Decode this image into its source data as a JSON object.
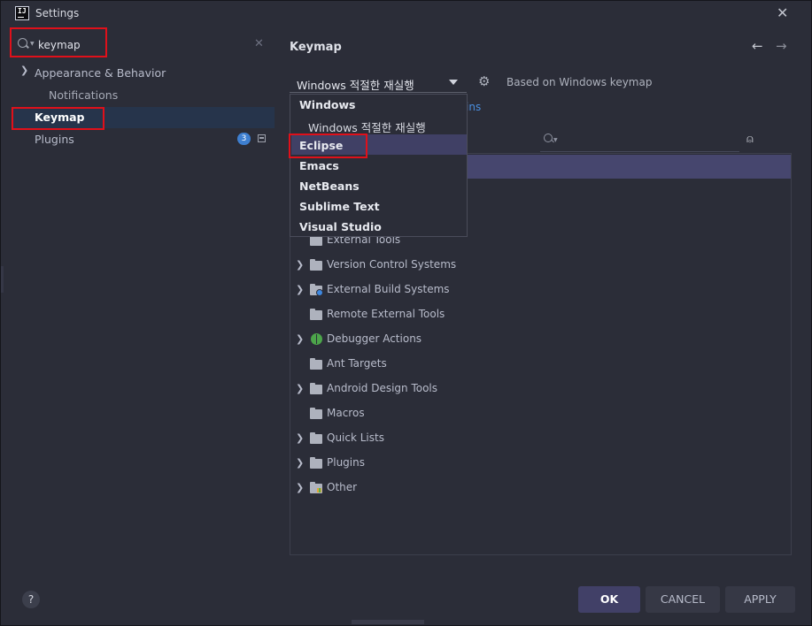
{
  "titlebar": {
    "title": "Settings",
    "logo_text": "IJ"
  },
  "search": {
    "value": "keymap",
    "placeholder": ""
  },
  "sidebar": {
    "items": [
      {
        "label": "Appearance & Behavior"
      },
      {
        "label": "Notifications"
      },
      {
        "label": "Keymap"
      },
      {
        "label": "Plugins",
        "badge": "3"
      }
    ]
  },
  "main": {
    "title": "Keymap",
    "keymap_select_value": "Windows 적절한 재실행",
    "based_on": "Based on Windows keymap",
    "plugins_link": "ins"
  },
  "dropdown": {
    "items": [
      {
        "label": "Windows"
      },
      {
        "label": "Windows 적절한 재실행"
      },
      {
        "label": "Eclipse"
      },
      {
        "label": "Emacs"
      },
      {
        "label": "NetBeans"
      },
      {
        "label": "Sublime Text"
      },
      {
        "label": "Visual Studio"
      }
    ]
  },
  "tree": {
    "rows": [
      {
        "label": "External Tools"
      },
      {
        "label": "Version Control Systems"
      },
      {
        "label": "External Build Systems"
      },
      {
        "label": "Remote External Tools"
      },
      {
        "label": "Debugger Actions"
      },
      {
        "label": "Ant Targets"
      },
      {
        "label": "Android Design Tools"
      },
      {
        "label": "Macros"
      },
      {
        "label": "Quick Lists"
      },
      {
        "label": "Plugins"
      },
      {
        "label": "Other"
      }
    ]
  },
  "footer": {
    "help": "?",
    "ok": "OK",
    "cancel": "CANCEL",
    "apply": "APPLY"
  },
  "colors": {
    "highlight": "#e0101a",
    "accent": "#414067",
    "link": "#4a8fe0"
  }
}
